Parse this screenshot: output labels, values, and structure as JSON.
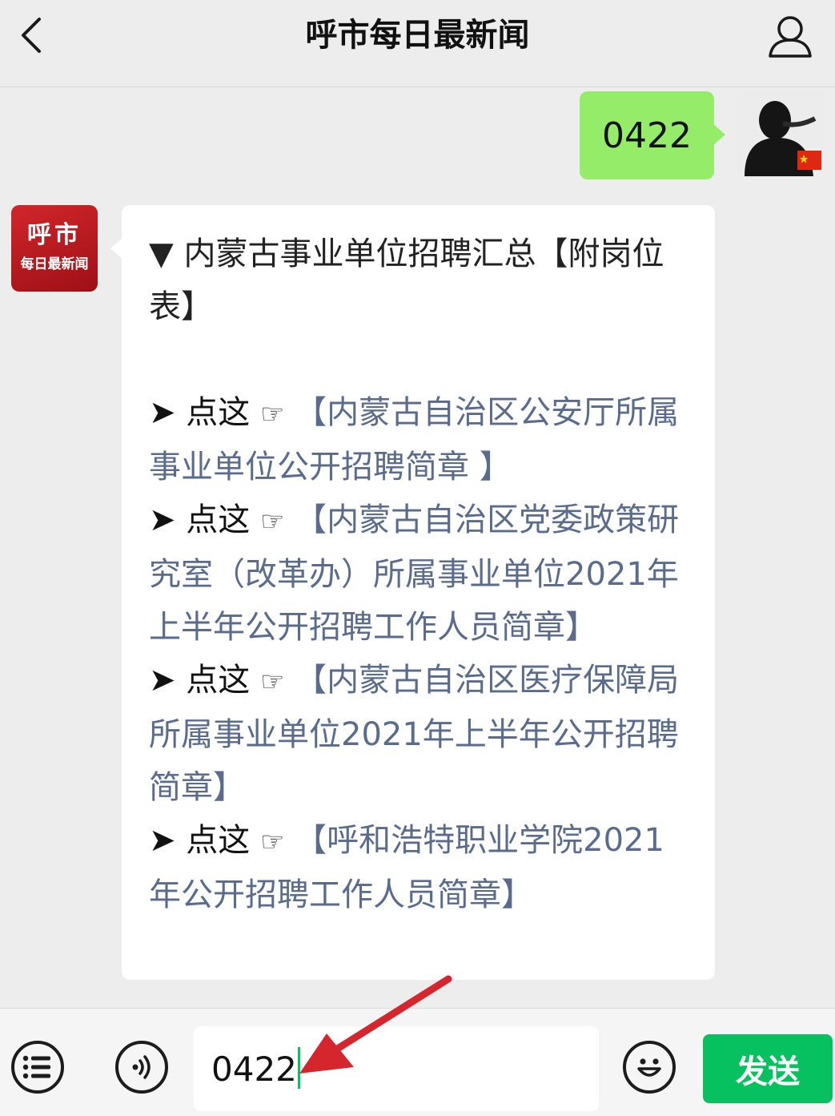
{
  "header": {
    "title": "呼市每日最新闻",
    "back_icon": "chevron-left-icon",
    "profile_icon": "user-icon"
  },
  "messages": {
    "outgoing": {
      "text": "0422"
    },
    "incoming": {
      "avatar": {
        "line1": "呼市",
        "line2": "每日最新闻"
      },
      "heading": "▼ 内蒙古事业单位招聘汇总【附岗位表】",
      "items": [
        {
          "arrow": "➤",
          "prefix": "点这",
          "hand": "☞",
          "link": "【内蒙古自治区公安厅所属事业单位公开招聘简章 】"
        },
        {
          "arrow": "➤",
          "prefix": "点这",
          "hand": "☞",
          "link": "【内蒙古自治区党委政策研究室（改革办）所属事业单位2021年上半年公开招聘工作人员简章】"
        },
        {
          "arrow": "➤",
          "prefix": "点这",
          "hand": "☞",
          "link": "【内蒙古自治区医疗保障局所属事业单位2021年上半年公开招聘简章】"
        },
        {
          "arrow": "➤",
          "prefix": "点这",
          "hand": "☞",
          "link": "【呼和浩特职业学院2021年公开招聘工作人员简章】"
        }
      ]
    }
  },
  "input_bar": {
    "menu_icon": "menu-list-icon",
    "voice_icon": "voice-icon",
    "input_value": "0422",
    "emoji_icon": "emoji-icon",
    "send_label": "发送"
  },
  "colors": {
    "send_green": "#07c160",
    "outgoing_bubble": "#95ec69",
    "link_color": "#5a6b8c",
    "annotation_red": "#d6262d"
  }
}
